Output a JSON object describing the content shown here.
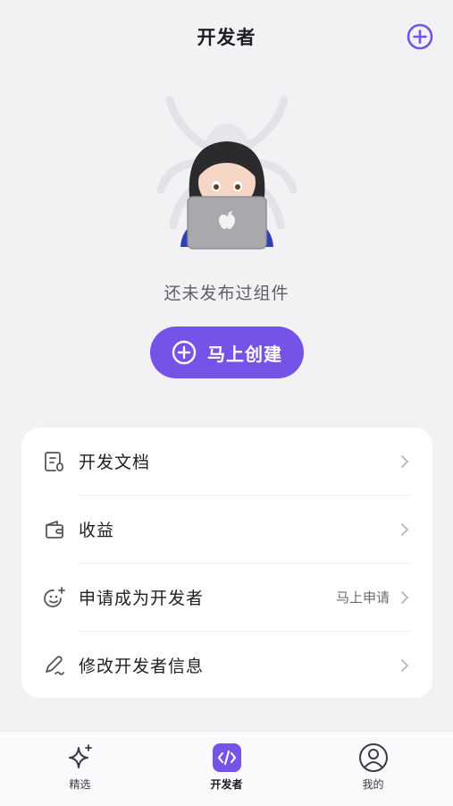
{
  "header": {
    "title": "开发者"
  },
  "empty_state": {
    "message": "还未发布过组件",
    "create_button_label": "马上创建"
  },
  "menu": {
    "items": [
      {
        "label": "开发文档",
        "icon": "document-icon",
        "right_text": ""
      },
      {
        "label": "收益",
        "icon": "wallet-icon",
        "right_text": ""
      },
      {
        "label": "申请成为开发者",
        "icon": "smiley-add-icon",
        "right_text": "马上申请"
      },
      {
        "label": "修改开发者信息",
        "icon": "edit-pen-icon",
        "right_text": ""
      }
    ]
  },
  "tabbar": {
    "tabs": [
      {
        "label": "精选",
        "icon": "sparkle-icon",
        "active": false
      },
      {
        "label": "开发者",
        "icon": "code-icon",
        "active": true
      },
      {
        "label": "我的",
        "icon": "profile-icon",
        "active": false
      }
    ]
  },
  "colors": {
    "accent": "#7553e8",
    "background": "#f2f2f5",
    "card": "#ffffff"
  }
}
